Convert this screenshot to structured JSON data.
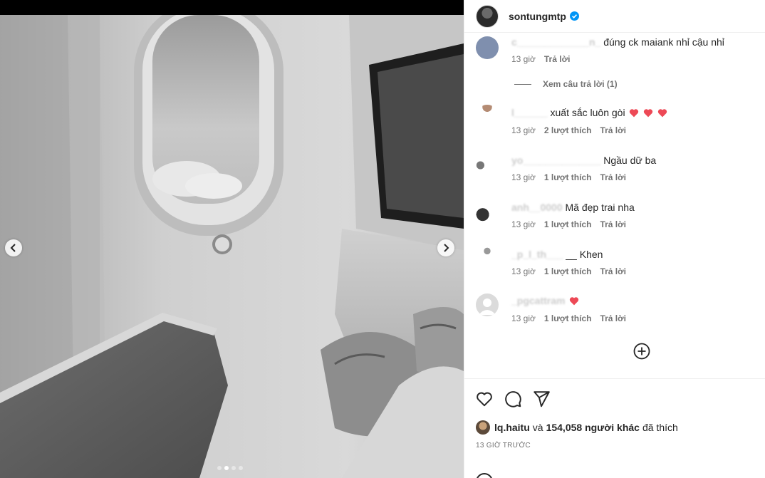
{
  "post": {
    "username": "sontungmtp",
    "verified": true,
    "image_description_icon": "airplane-seat-photo",
    "carousel": {
      "total": 4,
      "active_index": 1
    }
  },
  "comments": [
    {
      "user": "c_____________n_",
      "text": "đúng ck maiank nhỉ cậu nhỉ",
      "time": "13 giờ",
      "likes": "",
      "reply": "Trả lời",
      "view_replies": "Xem câu trả lời (1)"
    },
    {
      "user": "l______",
      "text": "xuất sắc luôn gòi",
      "hearts": 3,
      "time": "13 giờ",
      "likes": "2 lượt thích",
      "reply": "Trả lời"
    },
    {
      "user": "yo______________",
      "text": "Ngầu dữ ba",
      "time": "13 giờ",
      "likes": "1 lượt thích",
      "reply": "Trả lời"
    },
    {
      "user": "anh__0000",
      "text": "Mã đẹp trai nha",
      "time": "13 giờ",
      "likes": "1 lượt thích",
      "reply": "Trả lời"
    },
    {
      "user": "_p_l_th___",
      "text": "__ Khen",
      "time": "13 giờ",
      "likes": "1 lượt thích",
      "reply": "Trả lời"
    },
    {
      "user": "_pgcattram",
      "text": "",
      "hearts": 1,
      "time": "13 giờ",
      "likes": "1 lượt thích",
      "reply": "Trả lời"
    }
  ],
  "likes_summary": {
    "liker": "lq.haitu",
    "and": "và",
    "count": "154,058 người khác",
    "suffix": "đã thích"
  },
  "time_ago": "13 GIỜ TRƯỚC",
  "colors": {
    "heart": "#ed4956",
    "verified": "#0095f6",
    "muted": "#737373"
  }
}
